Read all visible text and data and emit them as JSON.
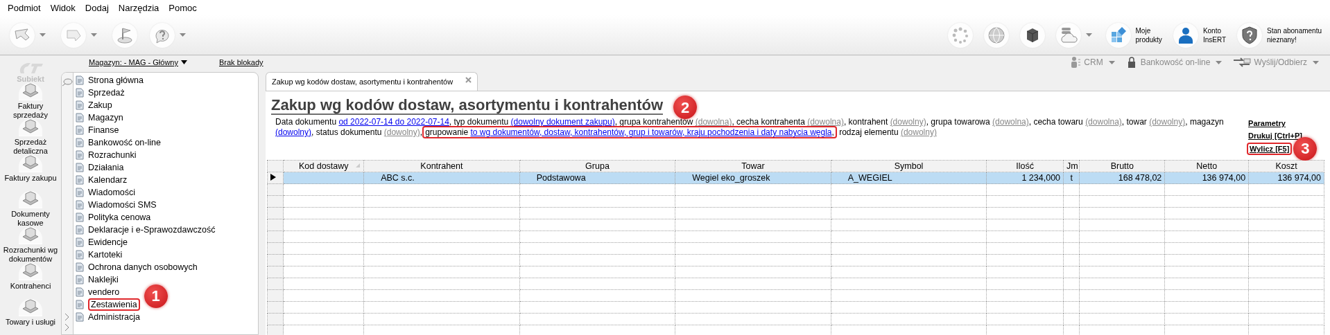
{
  "menu_bar": [
    "Podmiot",
    "Widok",
    "Dodaj",
    "Narzędzia",
    "Pomoc"
  ],
  "toolbar_right": [
    {
      "kind": "spinner"
    },
    {
      "kind": "globe"
    },
    {
      "kind": "cube"
    },
    {
      "kind": "cloud"
    },
    {
      "kind": "tiles",
      "lines": [
        "Moje",
        "produkty"
      ]
    },
    {
      "kind": "user",
      "lines": [
        "Konto",
        "InsERT"
      ]
    },
    {
      "kind": "shield",
      "lines": [
        "Stan abonamentu",
        "nieznany!"
      ]
    }
  ],
  "app_logo": "Subiekt",
  "nav_buttons": [
    "Faktury sprzedaży",
    "Sprzedaż detaliczna",
    "Faktury zakupu",
    "Dokumenty kasowe",
    "Rozrachunki wg dokumentów",
    "Kontrahenci",
    "Towary i usługi"
  ],
  "warehouse_link": "Magazyn: - MAG - Główny",
  "lock_link": "Brak blokady",
  "sub_buttons": [
    {
      "label": "CRM",
      "kind": "person",
      "disabled": true
    },
    {
      "label": "Bankowość on-line",
      "kind": "lock",
      "disabled": true
    },
    {
      "label": "Wyślij/Odbierz",
      "kind": "arrows",
      "disabled": true
    }
  ],
  "modules": [
    {
      "label": "Strona główna"
    },
    {
      "label": "Sprzedaż"
    },
    {
      "label": "Zakup"
    },
    {
      "label": "Magazyn"
    },
    {
      "label": "Finanse"
    },
    {
      "label": "Bankowość on-line"
    },
    {
      "label": "Rozrachunki"
    },
    {
      "label": "Działania"
    },
    {
      "label": "Kalendarz"
    },
    {
      "label": "Wiadomości"
    },
    {
      "label": "Wiadomości SMS"
    },
    {
      "label": "Polityka cenowa"
    },
    {
      "label": "Deklaracje i e-Sprawozdawczość"
    },
    {
      "label": "Ewidencje"
    },
    {
      "label": "Kartoteki"
    },
    {
      "label": "Ochrona danych osobowych"
    },
    {
      "label": "Naklejki"
    },
    {
      "label": "vendero"
    },
    {
      "label": "Zestawienia",
      "annotation": "1"
    },
    {
      "label": "Administracja"
    }
  ],
  "tab": {
    "title": "Zakup wg kodów dostaw, asortymentu i kontrahentów"
  },
  "report_title": "Zakup wg kodów dostaw, asortymentu i kontrahentów",
  "filters": [
    {
      "kind": "plain",
      "text": "Data dokumentu "
    },
    {
      "kind": "link",
      "text": "od 2022-07-14 do 2022-07-14"
    },
    {
      "kind": "plain",
      "text": ", typ dokumentu "
    },
    {
      "kind": "link",
      "text": "(dowolny dokument zakupu)"
    },
    {
      "kind": "plain",
      "text": ", grupa kontrahentów "
    },
    {
      "kind": "default",
      "text": "(dowolna)"
    },
    {
      "kind": "plain",
      "text": ", cecha kontrahenta "
    },
    {
      "kind": "default",
      "text": "(dowolna)"
    },
    {
      "kind": "plain",
      "text": ", kontrahent "
    },
    {
      "kind": "default",
      "text": "(dowolny)"
    },
    {
      "kind": "plain",
      "text": ", grupa towarowa "
    },
    {
      "kind": "default",
      "text": "(dowolna)"
    },
    {
      "kind": "plain",
      "text": ", cecha towaru "
    },
    {
      "kind": "default",
      "text": "(dowolna)"
    },
    {
      "kind": "plain",
      "text": ", towar "
    },
    {
      "kind": "default",
      "text": "(dowolny)"
    },
    {
      "kind": "plain",
      "text": ", magazyn"
    },
    {
      "kind": "break"
    },
    {
      "kind": "link",
      "text": "(dowolny)"
    },
    {
      "kind": "plain",
      "text": ", status dokumentu "
    },
    {
      "kind": "default",
      "text": "(dowolny)"
    },
    {
      "kind": "plain",
      "text": ","
    },
    {
      "kind": "group",
      "annotation": "2",
      "parts": [
        {
          "kind": "plain",
          "text": "grupowanie "
        },
        {
          "kind": "link",
          "text": "to wg dokumentów, dostaw, kontrahentów, grup i towarów, kraju pochodzenia i daty nabycia węgla"
        },
        {
          "kind": "plain",
          "text": ","
        }
      ]
    },
    {
      "kind": "plain",
      "text": " rodzaj elementu "
    },
    {
      "kind": "default",
      "text": "(dowolny)"
    }
  ],
  "actions": [
    {
      "label": "Parametry"
    },
    {
      "label": "Drukuj [Ctrl+P]"
    },
    {
      "label": "Wylicz [F5]",
      "annotation": "3"
    }
  ],
  "table": {
    "columns": [
      {
        "label": "Kod dostawy",
        "sorted": true
      },
      {
        "label": "Kontrahent",
        "sorted": false
      },
      {
        "label": "Grupa",
        "sorted": false
      },
      {
        "label": "Towar",
        "sorted": false
      },
      {
        "label": "Symbol",
        "sorted": false
      },
      {
        "label": "Ilość",
        "sorted": false
      },
      {
        "label": "Jm",
        "sorted": false
      },
      {
        "label": "Brutto",
        "sorted": false
      },
      {
        "label": "Netto",
        "sorted": false
      },
      {
        "label": "Koszt",
        "sorted": false
      }
    ],
    "rows": [
      {
        "selected": true,
        "cells": [
          null,
          "ABC s.c.",
          "Podstawowa",
          "Wegiel eko_groszek",
          "A_WEGIEL",
          "1 234,000",
          "t",
          "168 478,02",
          "136 974,00",
          "136 974,00"
        ]
      }
    ]
  }
}
